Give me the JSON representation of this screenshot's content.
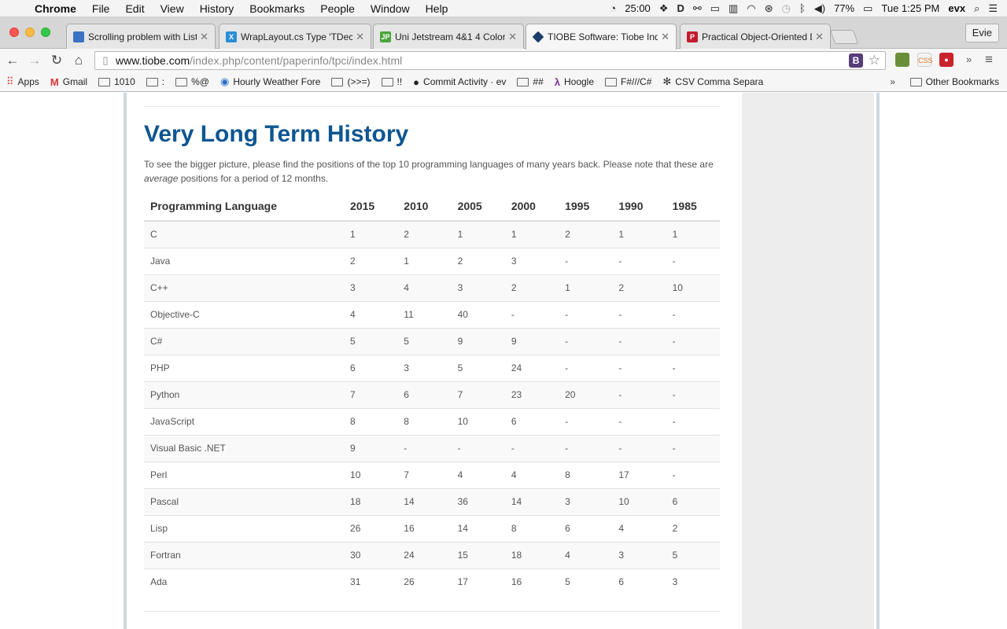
{
  "menubar": {
    "app_name": "Chrome",
    "menus": [
      "File",
      "Edit",
      "View",
      "History",
      "Bookmarks",
      "People",
      "Window",
      "Help"
    ],
    "timer": "25:00",
    "battery": "77%",
    "clock": "Tue 1:25 PM",
    "user": "evx"
  },
  "tabs": [
    {
      "title": "Scrolling problem with List",
      "favicon_color": "#3a72c4",
      "favicon_text": "",
      "active": false
    },
    {
      "title": "WrapLayout.cs Type 'TDec",
      "favicon_color": "#2b8ed8",
      "favicon_text": "X",
      "active": false
    },
    {
      "title": "Uni Jetstream 4&1 4 Color",
      "favicon_color": "#4aa53b",
      "favicon_text": "JP",
      "active": false
    },
    {
      "title": "TIOBE Software: Tiobe Ind",
      "favicon_color": "#1d3d6b",
      "favicon_text": "",
      "active": true
    },
    {
      "title": "Practical Object-Oriented D",
      "favicon_color": "#c21d2f",
      "favicon_text": "P",
      "active": false
    }
  ],
  "profile_name": "Evie",
  "omnibox": {
    "host": "www.tiobe.com",
    "path": "/index.php/content/paperinfo/tpci/index.html"
  },
  "bookmarks": [
    {
      "label": "Apps",
      "icon": "apps-icon"
    },
    {
      "label": "Gmail",
      "icon": "gmail-icon"
    },
    {
      "label": "1010",
      "icon": "folder-icon"
    },
    {
      "label": ":",
      "icon": "folder-icon"
    },
    {
      "label": "%@",
      "icon": "folder-icon"
    },
    {
      "label": "Hourly Weather Fore",
      "icon": "weather-icon"
    },
    {
      "label": "(>>=)",
      "icon": "folder-icon"
    },
    {
      "label": "!!",
      "icon": "folder-icon"
    },
    {
      "label": "Commit Activity · ev",
      "icon": "github-icon"
    },
    {
      "label": "##",
      "icon": "folder-icon"
    },
    {
      "label": "Hoogle",
      "icon": "lambda-icon"
    },
    {
      "label": "F#///C#",
      "icon": "folder-icon"
    },
    {
      "label": "CSV Comma Separa",
      "icon": "csv-icon"
    }
  ],
  "other_bookmarks": "Other Bookmarks",
  "page": {
    "heading": "Very Long Term History",
    "intro_before": "To see the bigger picture, please find the positions of the top 10 programming languages of many years back. Please note that these are ",
    "intro_em": "average",
    "intro_after": " positions for a period of 12 months.",
    "table": {
      "columns": [
        "Programming Language",
        "2015",
        "2010",
        "2005",
        "2000",
        "1995",
        "1990",
        "1985"
      ],
      "rows": [
        [
          "C",
          "1",
          "2",
          "1",
          "1",
          "2",
          "1",
          "1"
        ],
        [
          "Java",
          "2",
          "1",
          "2",
          "3",
          "-",
          "-",
          "-"
        ],
        [
          "C++",
          "3",
          "4",
          "3",
          "2",
          "1",
          "2",
          "10"
        ],
        [
          "Objective-C",
          "4",
          "11",
          "40",
          "-",
          "-",
          "-",
          "-"
        ],
        [
          "C#",
          "5",
          "5",
          "9",
          "9",
          "-",
          "-",
          "-"
        ],
        [
          "PHP",
          "6",
          "3",
          "5",
          "24",
          "-",
          "-",
          "-"
        ],
        [
          "Python",
          "7",
          "6",
          "7",
          "23",
          "20",
          "-",
          "-"
        ],
        [
          "JavaScript",
          "8",
          "8",
          "10",
          "6",
          "-",
          "-",
          "-"
        ],
        [
          "Visual Basic .NET",
          "9",
          "-",
          "-",
          "-",
          "-",
          "-",
          "-"
        ],
        [
          "Perl",
          "10",
          "7",
          "4",
          "4",
          "8",
          "17",
          "-"
        ],
        [
          "Pascal",
          "18",
          "14",
          "36",
          "14",
          "3",
          "10",
          "6"
        ],
        [
          "Lisp",
          "26",
          "16",
          "14",
          "8",
          "6",
          "4",
          "2"
        ],
        [
          "Fortran",
          "30",
          "24",
          "15",
          "18",
          "4",
          "3",
          "5"
        ],
        [
          "Ada",
          "31",
          "26",
          "17",
          "16",
          "5",
          "6",
          "3"
        ]
      ]
    }
  }
}
